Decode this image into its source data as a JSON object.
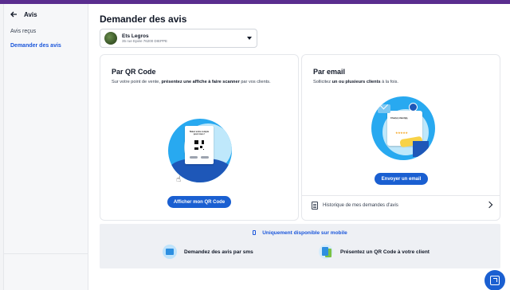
{
  "sidebar": {
    "title": "Avis",
    "items": [
      {
        "label": "Avis reçus",
        "active": false
      },
      {
        "label": "Demander des avis",
        "active": true
      }
    ]
  },
  "main": {
    "title": "Demander des avis",
    "location_select": {
      "name": "Ets Legros",
      "address": "35 rue Epiée 76200 DIEPPE"
    },
    "qr_card": {
      "title": "Par QR Code",
      "desc_prefix": "Sur votre point de vente, ",
      "desc_bold": "présentez une affiche à faire scanner",
      "desc_suffix": " par vos clients.",
      "poster_text": "Notez votre compte pour nous !",
      "button_label": "Afficher mon QR Code"
    },
    "email_card": {
      "title": "Par email",
      "desc_prefix": "Sollicitez ",
      "desc_bold": "un ou plusieurs clients",
      "desc_suffix": " à la fois.",
      "mail_text": "Cher(e) client(e),",
      "stars": "★★★★★",
      "button_label": "Envoyer un email",
      "history_label": "Historique de mes demandes d'avis"
    },
    "mobile_panel": {
      "heading": "Uniquement disponible sur mobile",
      "features": [
        {
          "label": "Demandez des avis par sms",
          "icon": "sms-icon"
        },
        {
          "label": "Présentez un QR Code à votre client",
          "icon": "qr-phone-icon"
        }
      ]
    }
  },
  "colors": {
    "accent": "#1a5fd1",
    "topbar": "#5a2d8f",
    "illustration_blue": "#28a9f0"
  }
}
